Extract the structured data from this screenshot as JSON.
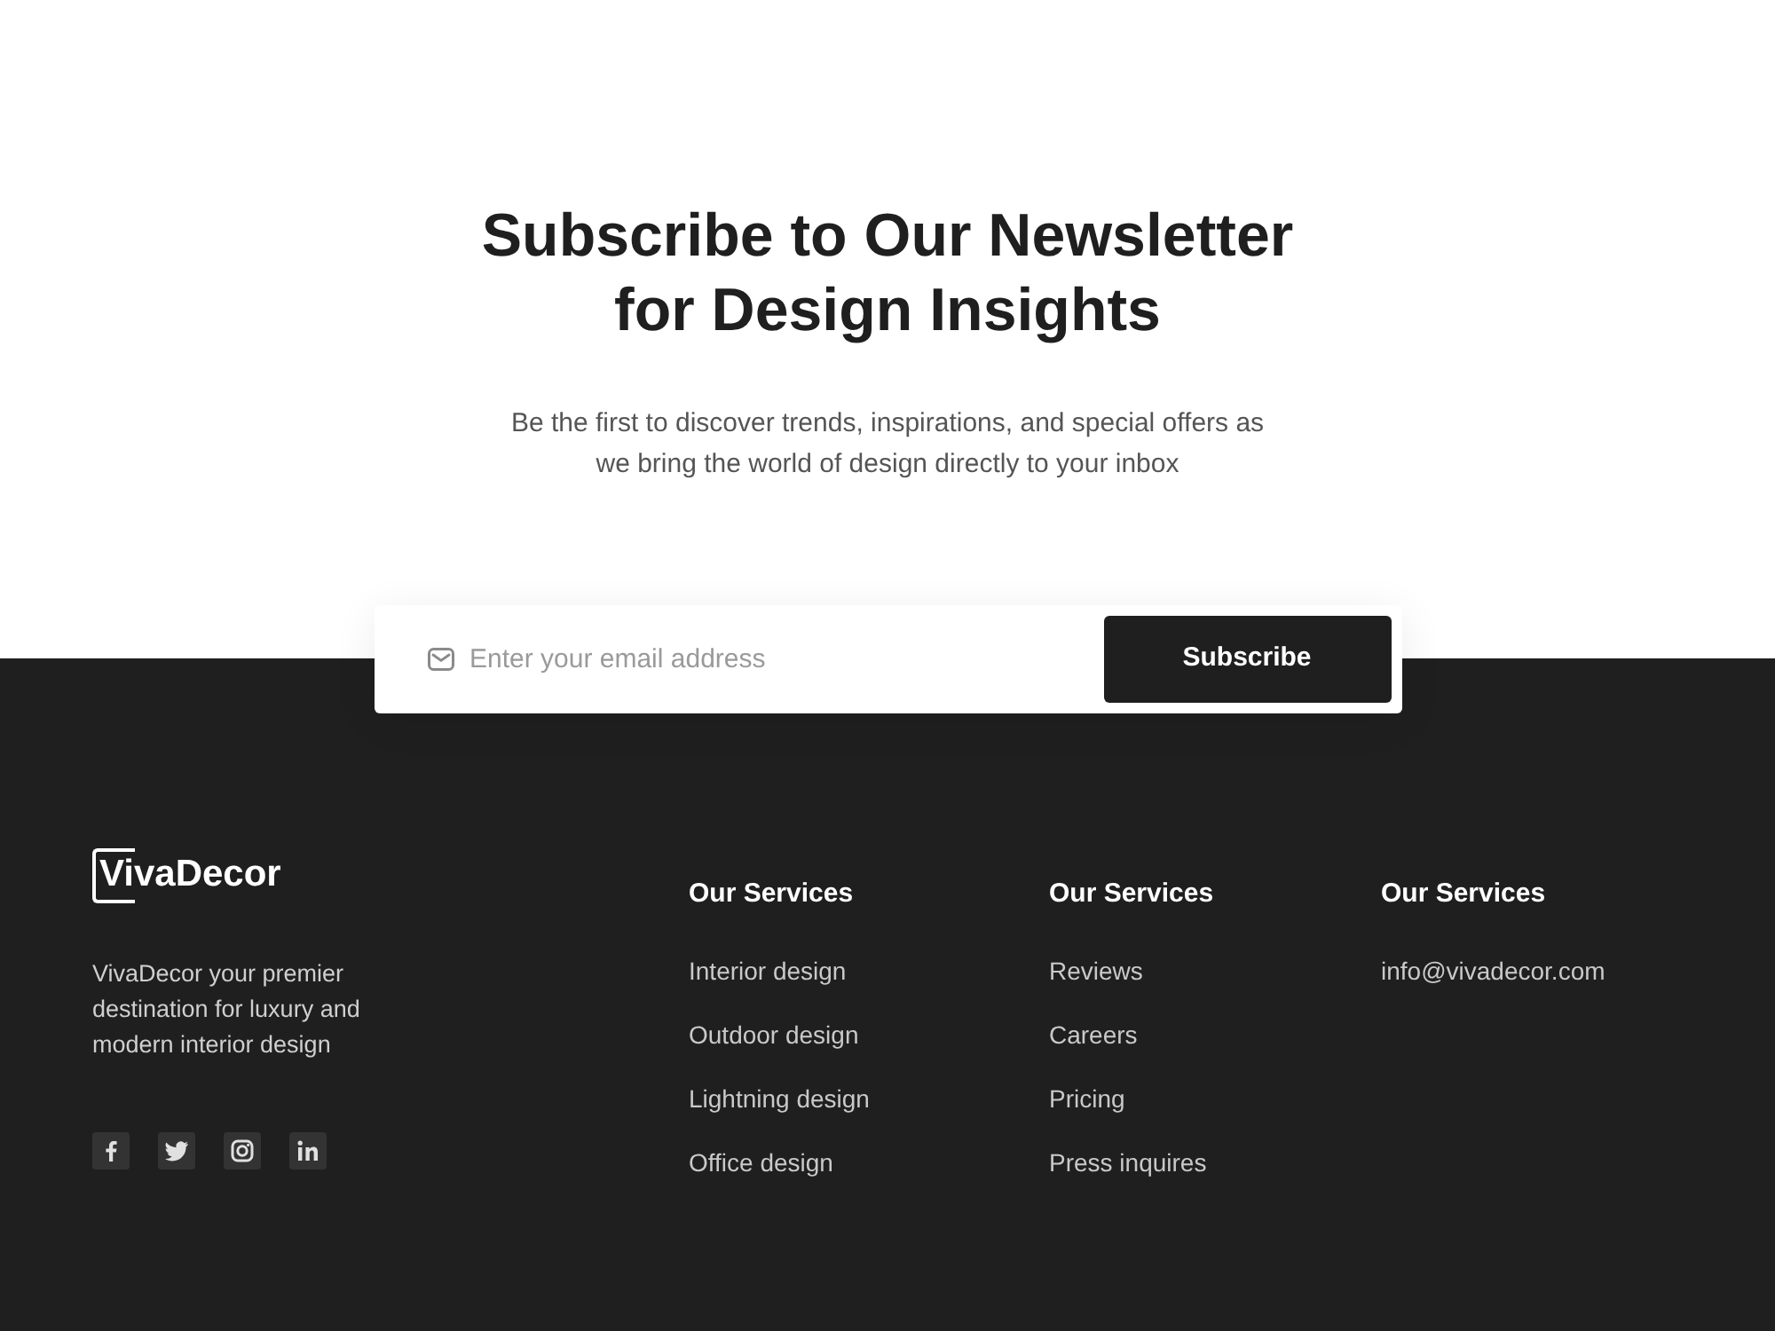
{
  "newsletter": {
    "title": "Subscribe to Our Newsletter for Design Insights",
    "description": "Be the first to discover trends, inspirations, and special offers as we bring the world of design directly to your inbox",
    "email_field": {
      "placeholder": "Enter your email address"
    },
    "button": "Subscribe"
  },
  "footer": {
    "logo": "VivaDecor",
    "tagline": "VivaDecor your premier destination for luxury and modern interior design",
    "columns": [
      {
        "heading": "Our Services",
        "links": [
          "Interior design",
          "Outdoor design",
          "Lightning design",
          "Office design"
        ]
      },
      {
        "heading": "Our Services",
        "links": [
          "Reviews",
          "Careers",
          "Pricing",
          "Press inquires"
        ]
      },
      {
        "heading": "Our Services",
        "links": [
          "info@vivadecor.com"
        ]
      }
    ]
  }
}
